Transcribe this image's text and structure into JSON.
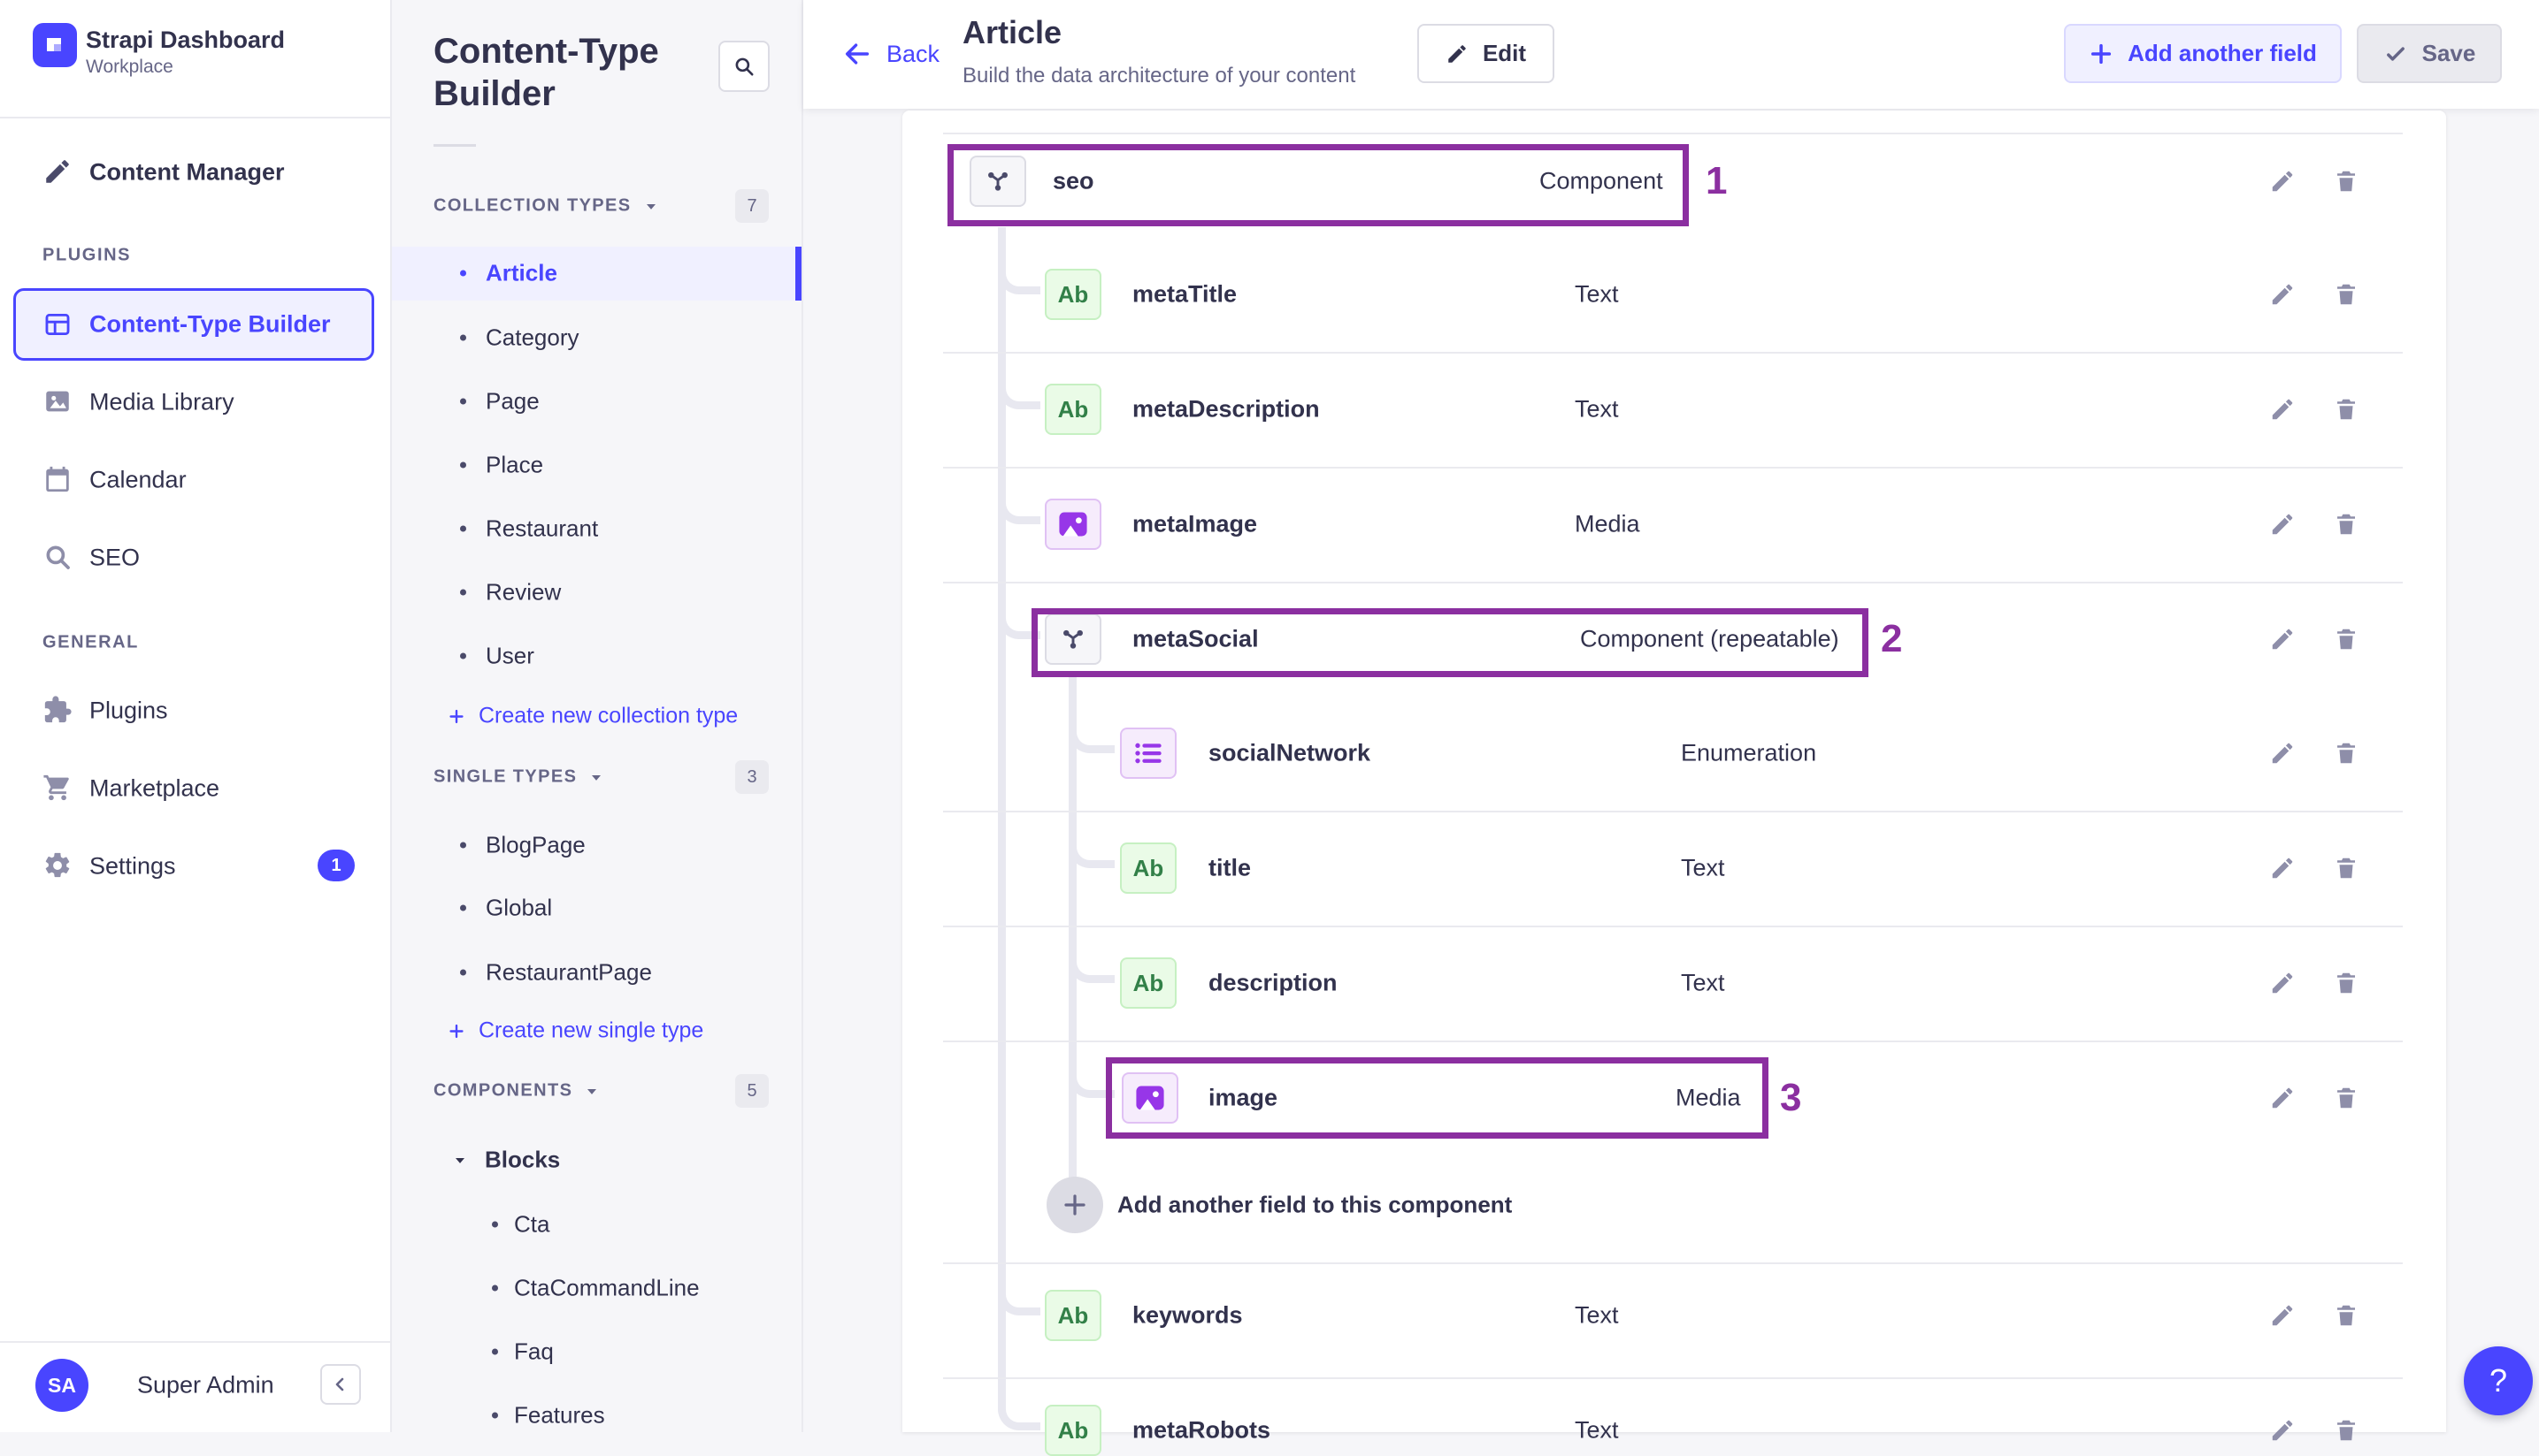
{
  "app": {
    "title": "Strapi Dashboard",
    "workspace": "Workplace"
  },
  "sidebar": {
    "content_manager": "Content Manager",
    "plugins_header": "PLUGINS",
    "general_header": "GENERAL",
    "plugin_items": [
      {
        "label": "Content-Type Builder",
        "icon": "content-type-builder-icon",
        "active": true
      },
      {
        "label": "Media Library",
        "icon": "media-library-icon"
      },
      {
        "label": "Calendar",
        "icon": "calendar-icon"
      },
      {
        "label": "SEO",
        "icon": "search-icon"
      }
    ],
    "general_items": [
      {
        "label": "Plugins",
        "icon": "puzzle-icon"
      },
      {
        "label": "Marketplace",
        "icon": "cart-icon"
      },
      {
        "label": "Settings",
        "icon": "gear-icon",
        "badge": "1"
      }
    ],
    "user": {
      "initials": "SA",
      "name": "Super Admin"
    }
  },
  "subnav": {
    "title": "Content-Type Builder",
    "collection": {
      "header": "COLLECTION TYPES",
      "count": "7",
      "items": [
        "Article",
        "Category",
        "Page",
        "Place",
        "Restaurant",
        "Review",
        "User"
      ],
      "active_item": "Article",
      "create": "Create new collection type"
    },
    "single": {
      "header": "SINGLE TYPES",
      "count": "3",
      "items": [
        "BlogPage",
        "Global",
        "RestaurantPage"
      ],
      "create": "Create new single type"
    },
    "components": {
      "header": "COMPONENTS",
      "count": "5",
      "group": "Blocks",
      "items": [
        "Cta",
        "CtaCommandLine",
        "Faq",
        "Features"
      ]
    }
  },
  "header": {
    "back": "Back",
    "title": "Article",
    "subtitle": "Build the data architecture of your content",
    "edit": "Edit",
    "add_field": "Add another field",
    "save": "Save"
  },
  "content": {
    "fields": [
      {
        "name": "seo",
        "type": "Component",
        "icon": "component-icon",
        "level": 0,
        "annotation": "1"
      },
      {
        "name": "metaTitle",
        "type": "Text",
        "icon": "text-icon",
        "level": 1
      },
      {
        "name": "metaDescription",
        "type": "Text",
        "icon": "text-icon",
        "level": 1
      },
      {
        "name": "metaImage",
        "type": "Media",
        "icon": "media-icon",
        "level": 1
      },
      {
        "name": "metaSocial",
        "type": "Component (repeatable)",
        "icon": "component-icon",
        "level": 1,
        "annotation": "2"
      },
      {
        "name": "socialNetwork",
        "type": "Enumeration",
        "icon": "enumeration-icon",
        "level": 2
      },
      {
        "name": "title",
        "type": "Text",
        "icon": "text-icon",
        "level": 2
      },
      {
        "name": "description",
        "type": "Text",
        "icon": "text-icon",
        "level": 2
      },
      {
        "name": "image",
        "type": "Media",
        "icon": "media-icon",
        "level": 2,
        "annotation": "3"
      },
      {
        "name": "keywords",
        "type": "Text",
        "icon": "text-icon",
        "level": 1
      },
      {
        "name": "metaRobots",
        "type": "Text",
        "icon": "text-icon",
        "level": 1
      }
    ],
    "text_icon_glyph": "Ab",
    "add_component_field": "Add another field to this component",
    "help": "?"
  },
  "colors": {
    "accent": "#4945ff",
    "accent_light": "#f0f0ff",
    "highlight": "#8b2fa0",
    "text": "#32324d",
    "muted": "#666687"
  }
}
